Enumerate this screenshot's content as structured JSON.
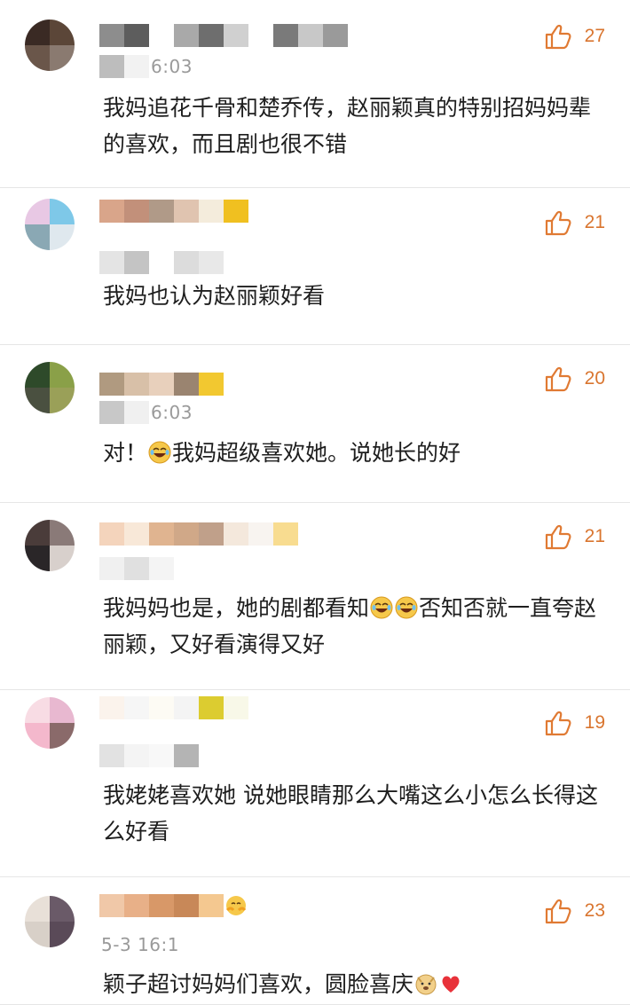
{
  "comments": [
    {
      "time": "6:03",
      "likes": "27",
      "text": "我妈追花千骨和楚乔传，赵丽颖真的特别招妈妈辈的喜欢，而且剧也很不错",
      "avatar_colors": [
        "#3a2a24",
        "#5b4638",
        "#6a564a",
        "#8a7a70"
      ],
      "name_mosaic": [
        "#8d8d8d",
        "#5d5d5d",
        "#ffffff",
        "#a9a9a9",
        "#6e6e6e",
        "#d0d0d0",
        "#ffffff",
        "#7a7a7a",
        "#c8c8c8",
        "#9a9a9a"
      ],
      "time_mosaic": [
        "#bdbdbd",
        "#f2f2f2"
      ]
    },
    {
      "time": "",
      "likes": "21",
      "text": "我妈也认为赵丽颖好看",
      "avatar_colors": [
        "#e8c8e4",
        "#7ec8e8",
        "#8aa8b4",
        "#dfe8ee"
      ],
      "name_mosaic": [
        "#d9a58a",
        "#c2907a",
        "#b09a88",
        "#e0c4b0",
        "#f4ecdc",
        "#f0c020"
      ],
      "time_mosaic": [
        "#e4e4e4",
        "#c4c4c4",
        "#ffffff",
        "#dcdcdc",
        "#e8e8e8"
      ]
    },
    {
      "time": "6:03",
      "likes": "20",
      "text": "对！我妈超级喜欢她。说她长的好",
      "avatar_colors": [
        "#2e4a2a",
        "#8aa048",
        "#4a5040",
        "#9aa058"
      ],
      "name_mosaic": [
        "#b09a80",
        "#d8c0a8",
        "#e8d0bc",
        "#9a8470",
        "#f2c830"
      ],
      "time_mosaic": [
        "#c8c8c8",
        "#f0f0f0"
      ]
    },
    {
      "time": "",
      "likes": "21",
      "text": "我妈妈也是，她的剧都看知否知否就一直夸赵丽颖，又好看演得又好",
      "avatar_colors": [
        "#4a3c3a",
        "#8a7a78",
        "#2a2628",
        "#d8d0cc"
      ],
      "name_mosaic": [
        "#f4d4bc",
        "#f8e8d8",
        "#e0b490",
        "#d0a888",
        "#c0a08a",
        "#f4e8dc",
        "#f8f4f0",
        "#f8dc90"
      ],
      "time_mosaic": [
        "#f0f0f0",
        "#e0e0e0",
        "#f4f4f4"
      ]
    },
    {
      "time": "",
      "likes": "19",
      "text": "我姥姥喜欢她 说她眼睛那么大嘴这么小怎么长得这么好看",
      "avatar_colors": [
        "#f8dce4",
        "#e8b8d0",
        "#f4b8cc",
        "#8a6a6a"
      ],
      "name_mosaic": [
        "#fbf3ec",
        "#f6f6f6",
        "#fdfbf4",
        "#f4f4f4",
        "#dccc30",
        "#f8f8e8"
      ],
      "time_mosaic": [
        "#e2e2e2",
        "#f4f4f4",
        "#f8f8f8",
        "#b4b4b4"
      ]
    },
    {
      "time": "5-3 16:1",
      "likes": "23",
      "text": "颖子超讨妈妈们喜欢，圆脸喜庆",
      "avatar_colors": [
        "#e8e0d8",
        "#6a5a68",
        "#d8d0c8",
        "#5a4a58"
      ],
      "name_mosaic": [
        "#f0c8a8",
        "#e8b088",
        "#d89868",
        "#c88858",
        "#f4c890"
      ],
      "time_mosaic": []
    }
  ],
  "icons": {
    "like": "thumbs-up-icon",
    "emoji_laugh": "laughing-crying-emoji-icon",
    "emoji_doge": "doge-emoji-icon",
    "emoji_heart": "red-heart-emoji-icon",
    "emoji_hug": "hug-emoji-icon"
  },
  "colors": {
    "like_accent": "#e07a33",
    "text": "#1e1e1e",
    "time": "#9a9a9a",
    "divider": "#e6e6e6"
  }
}
